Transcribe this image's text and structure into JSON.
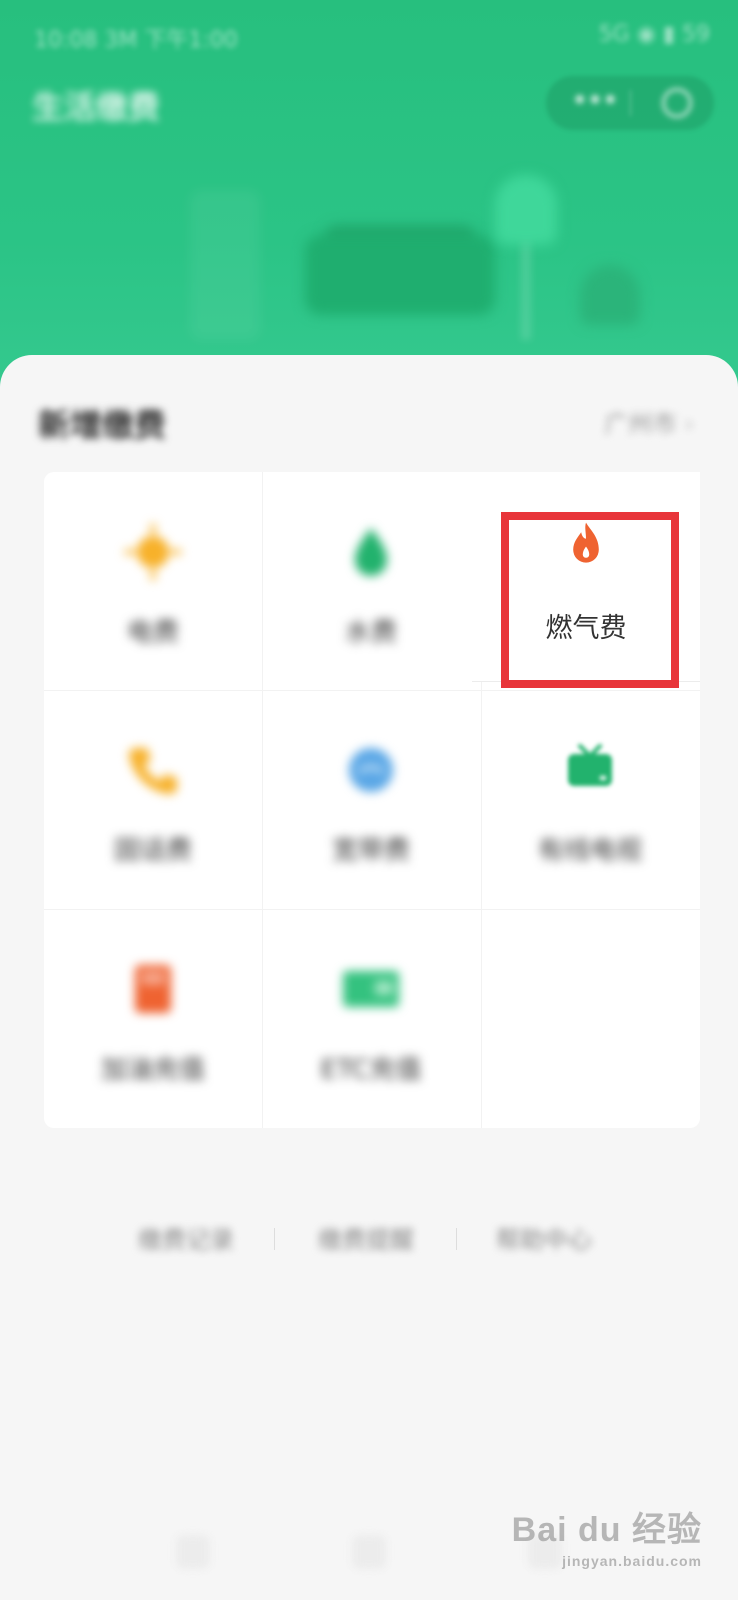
{
  "status_bar": {
    "time": "10:08 3M 下午1:00",
    "right": "5G ◉ ▮ 59"
  },
  "header": {
    "title": "生活缴费",
    "capsule_more": "•••"
  },
  "section": {
    "title": "新增缴费",
    "region": "广州市",
    "region_chevron": "›"
  },
  "services": [
    {
      "label": "电费",
      "icon": "electricity-icon",
      "color": "#f7b12a"
    },
    {
      "label": "水费",
      "icon": "water-drop-icon",
      "color": "#22b26d"
    },
    {
      "label": "燃气费",
      "icon": "gas-flame-icon",
      "color": "#ef6331"
    },
    {
      "label": "固话费",
      "icon": "phone-icon",
      "color": "#f7b12a"
    },
    {
      "label": "宽带费",
      "icon": "broadband-icon",
      "color": "#5aa7e6"
    },
    {
      "label": "有线电视",
      "icon": "tv-icon",
      "color": "#22b26d"
    },
    {
      "label": "加油充值",
      "icon": "fuel-card-icon",
      "color": "#ef6331"
    },
    {
      "label": "ETC充值",
      "icon": "etc-card-icon",
      "color": "#34c27f"
    }
  ],
  "bottom_links": [
    "缴费记录",
    "缴费提醒",
    "帮助中心"
  ],
  "watermark": {
    "main": "Bai du 经验",
    "sub": "jingyan.baidu.com"
  }
}
